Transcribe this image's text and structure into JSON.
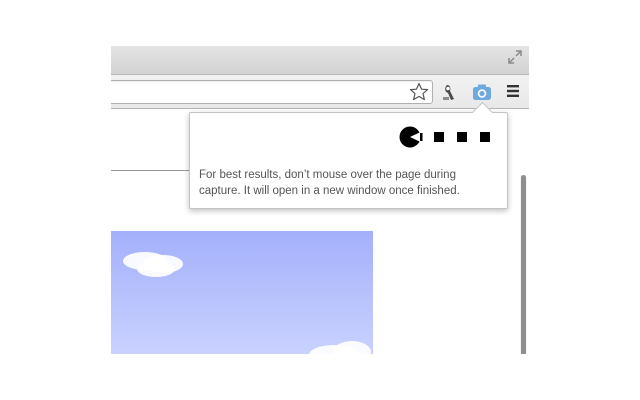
{
  "browser": {
    "omnibox": {
      "value": ""
    },
    "toolbar_icons": [
      "star-icon",
      "extension-icon",
      "camera-icon",
      "menu-icon"
    ],
    "window_icons": [
      "fullscreen-icon"
    ]
  },
  "popup": {
    "message": "For best results, don’t mouse over the page during capture. It will open in a new window once finished.",
    "graphic": "pacman-eating-dots-progress-icon"
  },
  "colors": {
    "camera_icon": "#6fa8dc",
    "popup_text": "#555555",
    "sky_top": "#a4b0fb",
    "sky_bottom": "#c9d2fe"
  }
}
